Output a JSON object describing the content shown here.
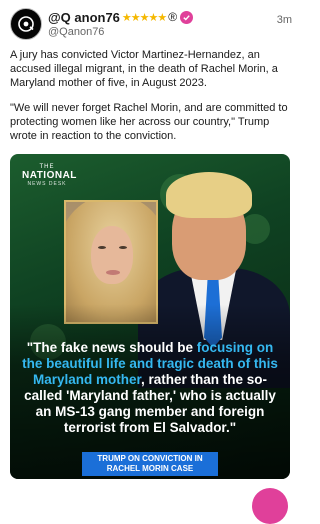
{
  "post": {
    "display_name": "@Q anon76",
    "stars": "★★★★★",
    "reg": "®",
    "handle": "@Qanon76",
    "timestamp": "3m",
    "paragraph_1": "A jury has convicted Victor Martinez-Hernandez, an accused illegal migrant, in the death of Rachel Morin, a Maryland mother of five, in August 2023.",
    "paragraph_2": "\"We will never forget Rachel Morin, and are committed to protecting women like her across our country,\" Trump wrote in reaction to the conviction."
  },
  "media": {
    "logo_the": "THE",
    "logo_main": "NATIONAL",
    "logo_sub": "NEWS DESK",
    "quote_part1": "\"The fake news should be ",
    "quote_highlight": "focusing on the beautiful life and tragic death of this Maryland mother",
    "quote_part2": ", rather than the so-called 'Maryland father,' who is actually an MS-13 gang member and foreign terrorist from El Salvador.\"",
    "caption": "TRUMP ON CONVICTION IN RACHEL MORIN CASE"
  },
  "colors": {
    "accent_pink": "#e0409a",
    "star_gold": "#f5b800",
    "highlight_blue": "#35b8f0",
    "caption_blue": "#1b6fd8"
  },
  "icons": [
    "app-avatar-icon",
    "verified-badge-icon"
  ]
}
